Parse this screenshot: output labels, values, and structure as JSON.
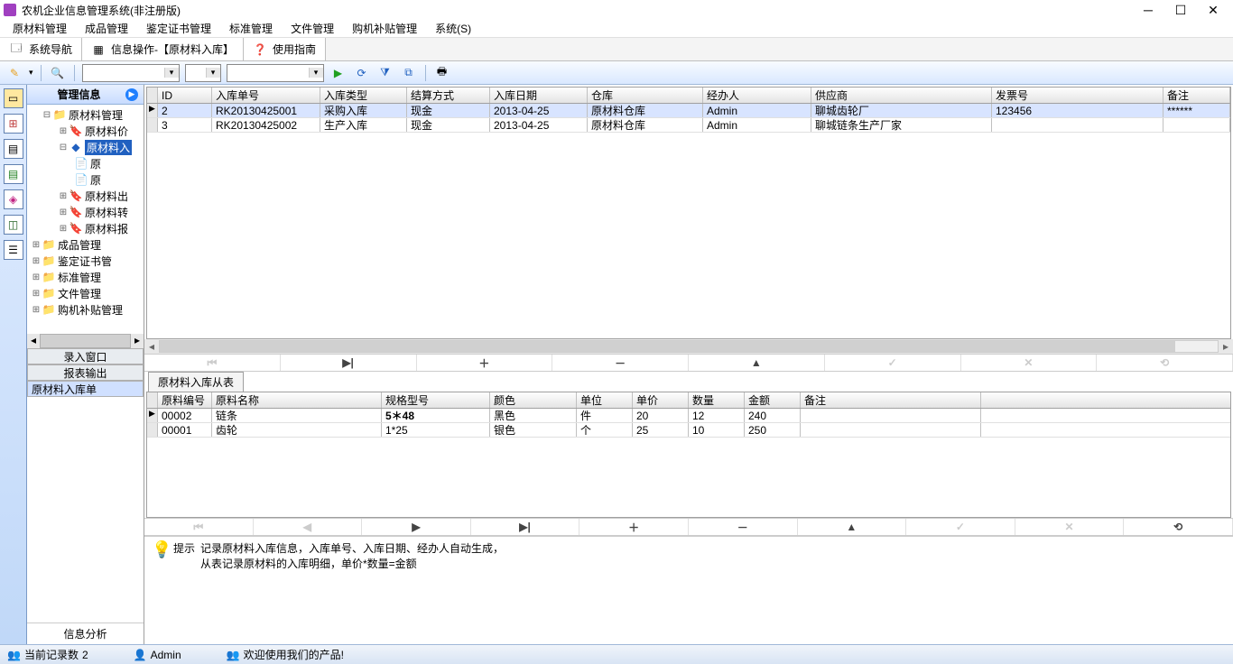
{
  "window": {
    "title": "农机企业信息管理系统(非注册版)"
  },
  "menu": [
    "原材料管理",
    "成品管理",
    "鉴定证书管理",
    "标准管理",
    "文件管理",
    "购机补贴管理",
    "系统(S)"
  ],
  "tooltabs": {
    "nav": "系统导航",
    "info": "信息操作-【原材料入库】",
    "help": "使用指南"
  },
  "sidebar": {
    "header": "管理信息",
    "tree": {
      "root": "原材料管理",
      "n1": "原材料价",
      "n2": "原材料入",
      "n2a": "原",
      "n2b": "原",
      "n3": "原材料出",
      "n4": "原材料转",
      "n5": "原材料报",
      "s1": "成品管理",
      "s2": "鉴定证书管",
      "s3": "标准管理",
      "s4": "文件管理",
      "s5": "购机补贴管理"
    },
    "buttons": {
      "b1": "录入窗口",
      "b2": "报表输出",
      "b3": "原材料入库单"
    },
    "foot": "信息分析"
  },
  "grid1": {
    "cols": [
      "ID",
      "入库单号",
      "入库类型",
      "结算方式",
      "入库日期",
      "仓库",
      "经办人",
      "供应商",
      "发票号",
      "备注"
    ],
    "rows": [
      {
        "id": "2",
        "no": "RK20130425001",
        "type": "采购入库",
        "pay": "现金",
        "date": "2013-04-25",
        "wh": "原材料仓库",
        "op": "Admin",
        "sup": "聊城齿轮厂",
        "inv": "123456",
        "note": "******"
      },
      {
        "id": "3",
        "no": "RK20130425002",
        "type": "生产入库",
        "pay": "现金",
        "date": "2013-04-25",
        "wh": "原材料仓库",
        "op": "Admin",
        "sup": "聊城链条生产厂家",
        "inv": "",
        "note": ""
      }
    ]
  },
  "subtab": "原材料入库从表",
  "grid2": {
    "cols": [
      "原料编号",
      "原料名称",
      "规格型号",
      "颜色",
      "单位",
      "单价",
      "数量",
      "金额",
      "备注"
    ],
    "rows": [
      {
        "code": "00002",
        "name": "链条",
        "spec": "5＊48",
        "color": "黑色",
        "unit": "件",
        "price": "20",
        "qty": "12",
        "amt": "240",
        "note": ""
      },
      {
        "code": "00001",
        "name": "齿轮",
        "spec": "1*25",
        "color": "银色",
        "unit": "个",
        "price": "25",
        "qty": "10",
        "amt": "250",
        "note": ""
      }
    ]
  },
  "hint": {
    "label": "提示",
    "line1": "记录原材料入库信息，入库单号、入库日期、经办人自动生成，",
    "line2": "从表记录原材料的入库明细，单价*数量=金额"
  },
  "status": {
    "count_label": "当前记录数",
    "count": "2",
    "user": "Admin",
    "welcome": "欢迎使用我们的产品!"
  }
}
